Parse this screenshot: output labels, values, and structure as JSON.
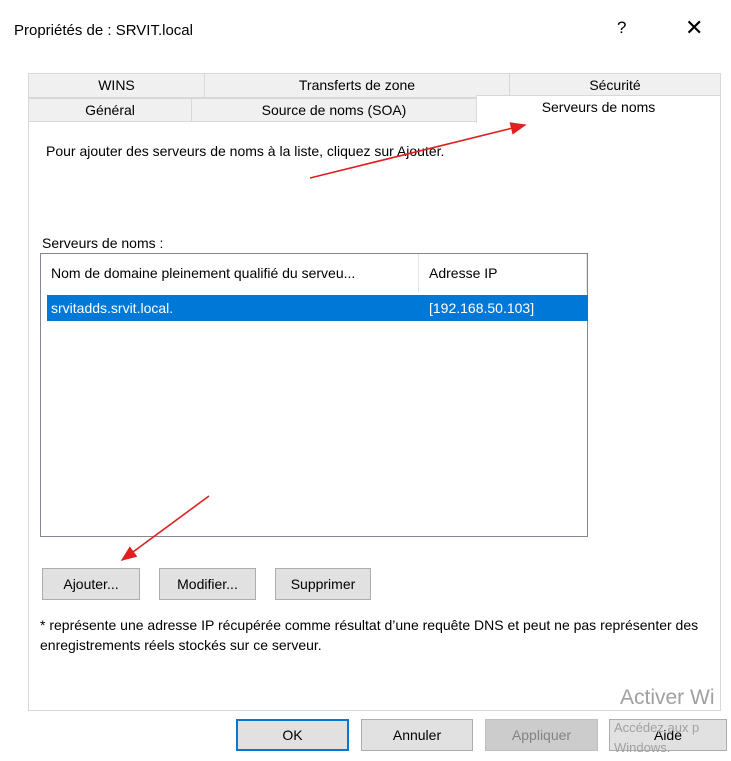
{
  "window": {
    "title": "Propriétés de : SRVIT.local",
    "help_glyph": "?",
    "close_glyph": "✕"
  },
  "tabs": {
    "row_back": [
      "WINS",
      "Transferts de zone",
      "Sécurité"
    ],
    "row_front": [
      "Général",
      "Source de noms (SOA)",
      "Serveurs de noms"
    ],
    "active": "Serveurs de noms"
  },
  "panel": {
    "instruction": "Pour ajouter des serveurs de noms à la liste, cliquez sur Ajouter.",
    "list_label": "Serveurs de noms :",
    "columns": [
      "Nom de domaine pleinement qualifié du serveu...",
      "Adresse IP"
    ],
    "rows": [
      {
        "fqdn": "srvitadds.srvit.local.",
        "ip": "[192.168.50.103]",
        "selected": true
      }
    ],
    "buttons": {
      "add": "Ajouter...",
      "edit": "Modifier...",
      "remove": "Supprimer"
    },
    "note": "* représente une adresse IP récupérée comme résultat d’une requête DNS et peut ne pas représenter des enregistrements réels stockés sur ce serveur."
  },
  "footer": {
    "ok": "OK",
    "cancel": "Annuler",
    "apply": "Appliquer",
    "help": "Aide"
  },
  "watermark": {
    "line1": "Activer Wi",
    "line2": "Accédez aux p",
    "line3": "Windows."
  },
  "colors": {
    "accent": "#0078d7",
    "annotation_arrow": "#e02020"
  }
}
